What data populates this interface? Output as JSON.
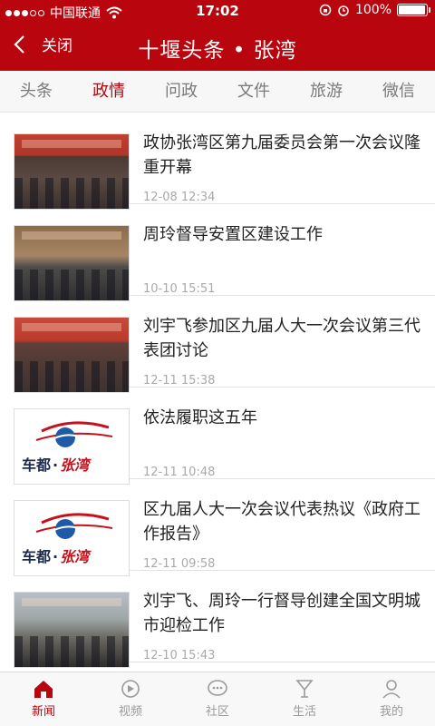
{
  "status": {
    "carrier": "中国联通",
    "time": "17:02",
    "battery": "100%",
    "battery_level": 1.0
  },
  "nav": {
    "back_label": "关闭",
    "title": "十堰头条 • 张湾"
  },
  "tabs": [
    {
      "label": "头条",
      "active": false
    },
    {
      "label": "政情",
      "active": true
    },
    {
      "label": "问政",
      "active": false
    },
    {
      "label": "文件",
      "active": false
    },
    {
      "label": "旅游",
      "active": false
    },
    {
      "label": "微信",
      "active": false
    }
  ],
  "articles": [
    {
      "title": "政协张湾区第九届委员会第一次会议隆重开幕",
      "date": "12-08 12:34",
      "thumb": "photo1"
    },
    {
      "title": "周玲督导安置区建设工作",
      "date": "10-10 15:51",
      "thumb": "photo2"
    },
    {
      "title": "刘宇飞参加区九届人大一次会议第三代表团讨论",
      "date": "12-11 15:38",
      "thumb": "photo3"
    },
    {
      "title": "依法履职这五年",
      "date": "12-11 10:48",
      "thumb": "logo"
    },
    {
      "title": "区九届人大一次会议代表热议《政府工作报告》",
      "date": "12-11 09:58",
      "thumb": "logo"
    },
    {
      "title": "刘宇飞、周玲一行督导创建全国文明城市迎检工作",
      "date": "12-10 15:43",
      "thumb": "photo4"
    }
  ],
  "logo_text": {
    "left": "车都",
    "dot": "·",
    "right": "张湾"
  },
  "tabbar": [
    {
      "label": "新闻",
      "icon": "home-icon",
      "active": true
    },
    {
      "label": "视频",
      "icon": "video-icon",
      "active": false
    },
    {
      "label": "社区",
      "icon": "community-icon",
      "active": false
    },
    {
      "label": "生活",
      "icon": "cocktail-icon",
      "active": false
    },
    {
      "label": "我的",
      "icon": "profile-icon",
      "active": false
    }
  ],
  "colors": {
    "accent": "#b9060e",
    "inactive": "#9a9a9a"
  }
}
